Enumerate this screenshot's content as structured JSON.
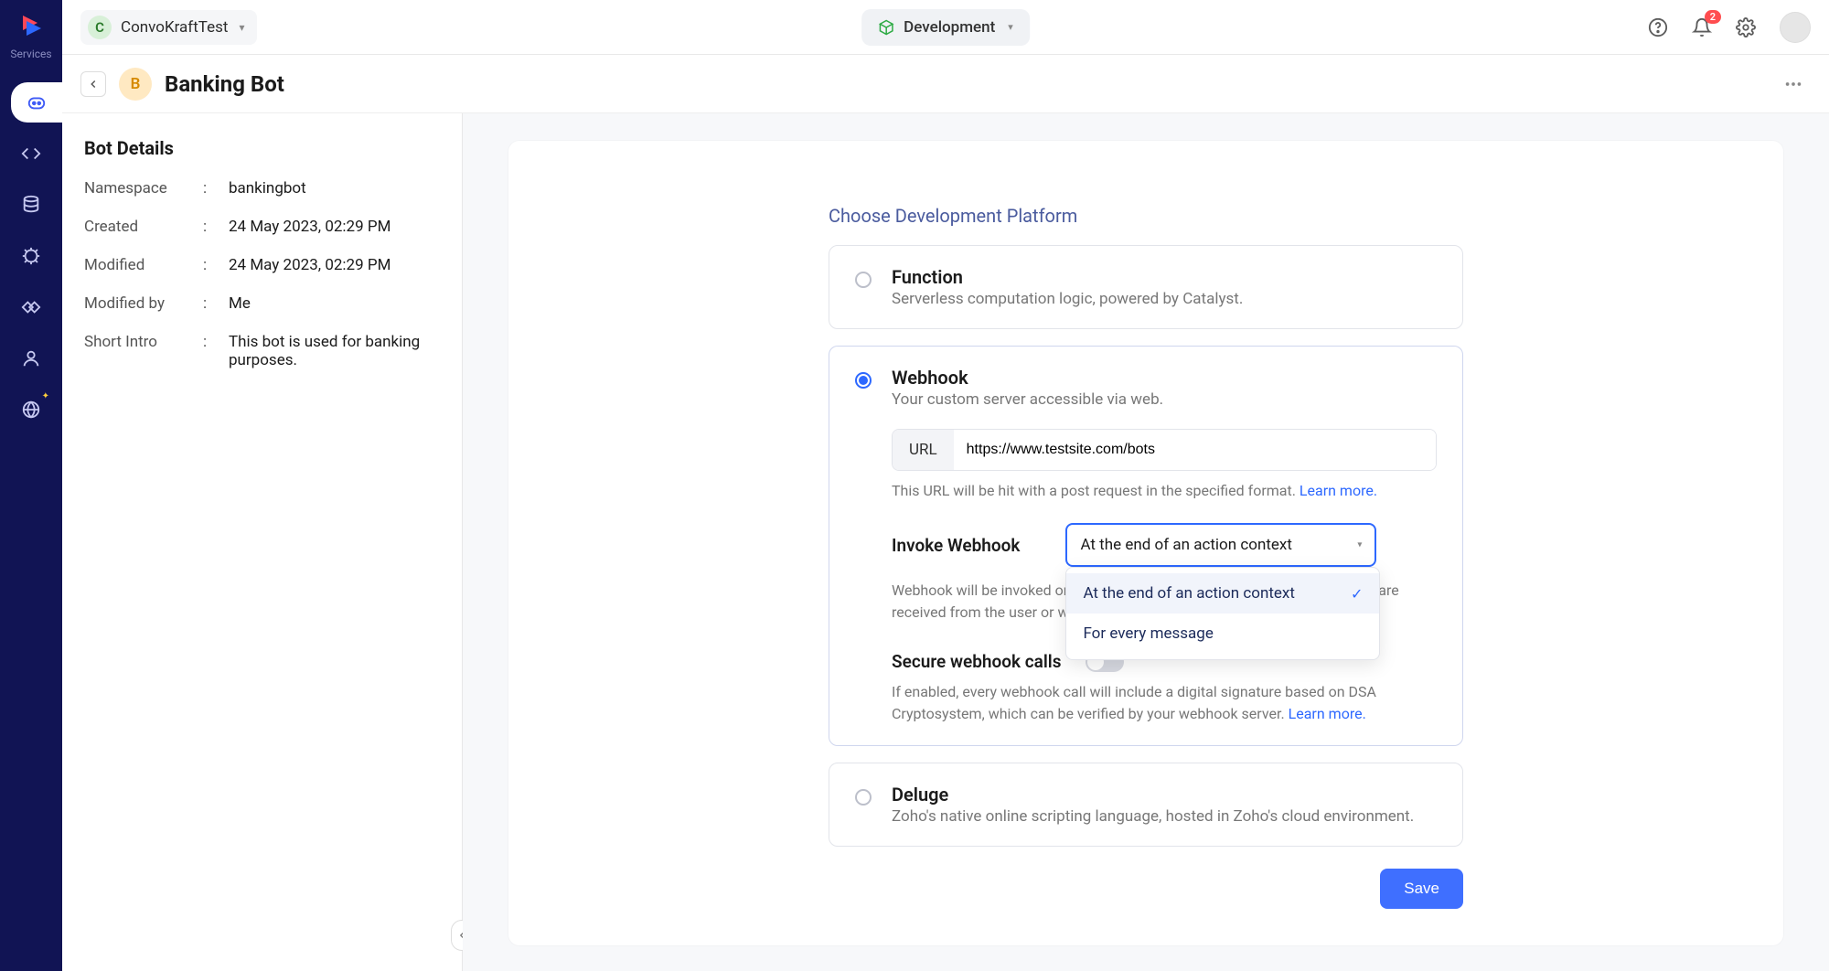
{
  "header": {
    "project_letter": "C",
    "project_name": "ConvoKraftTest",
    "environment": "Development",
    "notification_count": "2"
  },
  "leftrail": {
    "services_label": "Services"
  },
  "subheader": {
    "avatar_letter": "B",
    "title": "Banking Bot"
  },
  "details": {
    "heading": "Bot Details",
    "rows": {
      "namespace_label": "Namespace",
      "namespace_value": "bankingbot",
      "created_label": "Created",
      "created_value": "24 May 2023, 02:29 PM",
      "modified_label": "Modified",
      "modified_value": "24 May 2023, 02:29 PM",
      "modifiedby_label": "Modified by",
      "modifiedby_value": "Me",
      "intro_label": "Short Intro",
      "intro_value": "This bot is used for banking purposes."
    }
  },
  "main": {
    "section_title": "Choose Development Platform",
    "function": {
      "title": "Function",
      "desc": "Serverless computation logic, powered by Catalyst."
    },
    "webhook": {
      "title": "Webhook",
      "desc": "Your custom server accessible via web.",
      "url_label": "URL",
      "url_value": "https://www.testsite.com/bots",
      "url_helper_prefix": "This URL will be hit with a post request in the specified format. ",
      "url_learn_more": "Learn more.",
      "invoke_label": "Invoke Webhook",
      "invoke_selected": "At the end of an action context",
      "invoke_options": {
        "opt1": "At the end of an action context",
        "opt2": "For every message"
      },
      "invoke_helper": "Webhook will be invoked only when all the params configured for an action are received from the user or wh",
      "secure_label": "Secure webhook calls",
      "secure_helper_prefix": "If enabled, every webhook call will include a digital signature based on DSA Cryptosystem, which can be verified by your webhook server. ",
      "secure_learn_more": "Learn more."
    },
    "deluge": {
      "title": "Deluge",
      "desc": "Zoho's native online scripting language, hosted in Zoho's cloud environment."
    },
    "save_label": "Save"
  }
}
